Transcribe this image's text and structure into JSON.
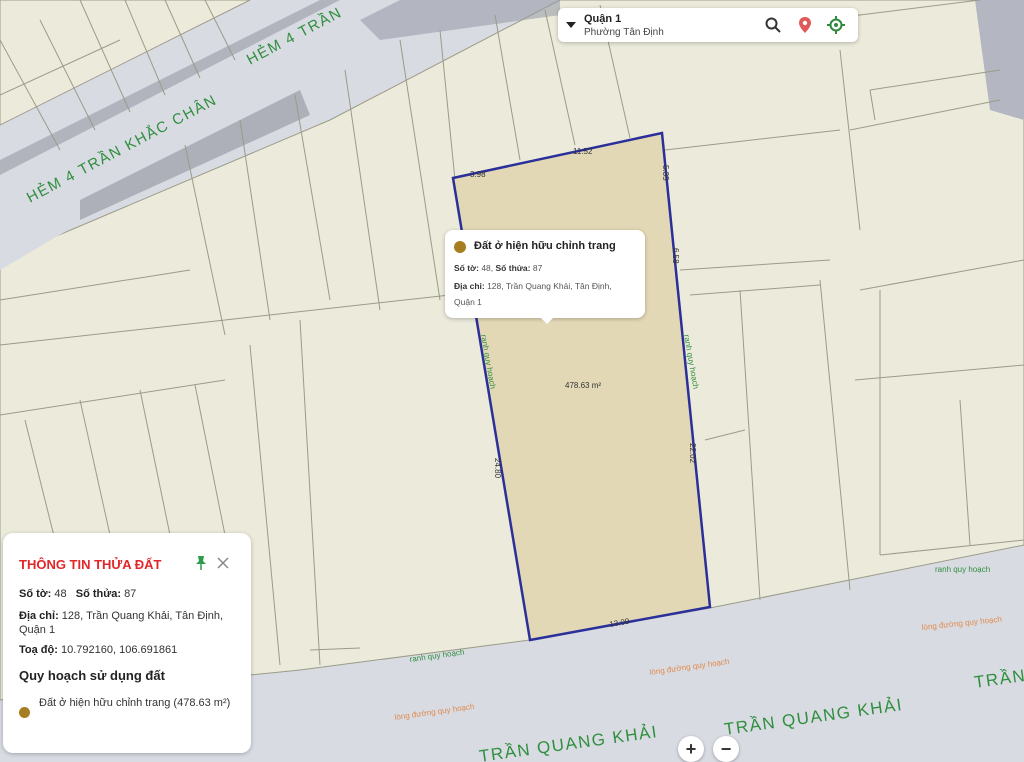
{
  "location_bar": {
    "district": "Quận 1",
    "ward": "Phường Tân Định"
  },
  "streets": {
    "hem_diag": "HẺM 4 TRẦN KHẮC CHÂN",
    "hem_top": "HẺM 4 TRẦN",
    "tqk_main": "TRẦN QUANG KHẢI",
    "tqk_partial": "TRẦN QUANG KHẢI",
    "tqk_right": "TRẦN"
  },
  "map_labels": {
    "ranh_qh": "ranh quy hoạch",
    "long_duong": "lòng đường quy hoạch",
    "area": "478.63 m²"
  },
  "edge_lengths": {
    "top_left": "3.98",
    "top_mid": "11.52",
    "right_top": "5.35",
    "right_mid": "6.58",
    "right_low": "22.02",
    "left": "24.80",
    "bottom": "13.09"
  },
  "popup": {
    "title": "Đất ở hiện hữu chỉnh trang",
    "so_to_label": "Số tờ:",
    "so_to": "48",
    "so_thua_label": "Số thửa:",
    "so_thua": "87",
    "dia_chi_label": "Địa chỉ:",
    "dia_chi_line1": "128, Trần Quang Khải, Tân Định,",
    "dia_chi_line2": "Quận 1"
  },
  "info_panel": {
    "title": "THÔNG TIN THỬA ĐẤT",
    "so_to_label": "Số tờ:",
    "so_to": "48",
    "so_thua_label": "Số thửa:",
    "so_thua": "87",
    "dia_chi_label": "Địa chỉ:",
    "dia_chi_line1": "128, Trần Quang Khải, Tân Định,",
    "dia_chi_line2": "Quận 1",
    "toa_do_label": "Toạ độ:",
    "toa_do": "10.792160, 106.691861",
    "section_title": "Quy hoạch sử dụng đất",
    "legend_text": "Đất ở hiện hữu chỉnh trang (478.63 m²)"
  },
  "zoom": {
    "in": "+",
    "out": "−"
  },
  "colors": {
    "parcel_fill": "#e3d8b6",
    "land_use_dot": "#a77d22",
    "parcel_border": "#2a2f9a",
    "street_label": "#2f8f3e",
    "planning_label": "#2f8f3e",
    "road_label_orange": "#e08a4a",
    "header_red": "#e2262a"
  },
  "icons": [
    "caret-down-icon",
    "search-icon",
    "map-pin-icon",
    "locate-icon",
    "pin-icon",
    "close-icon"
  ]
}
